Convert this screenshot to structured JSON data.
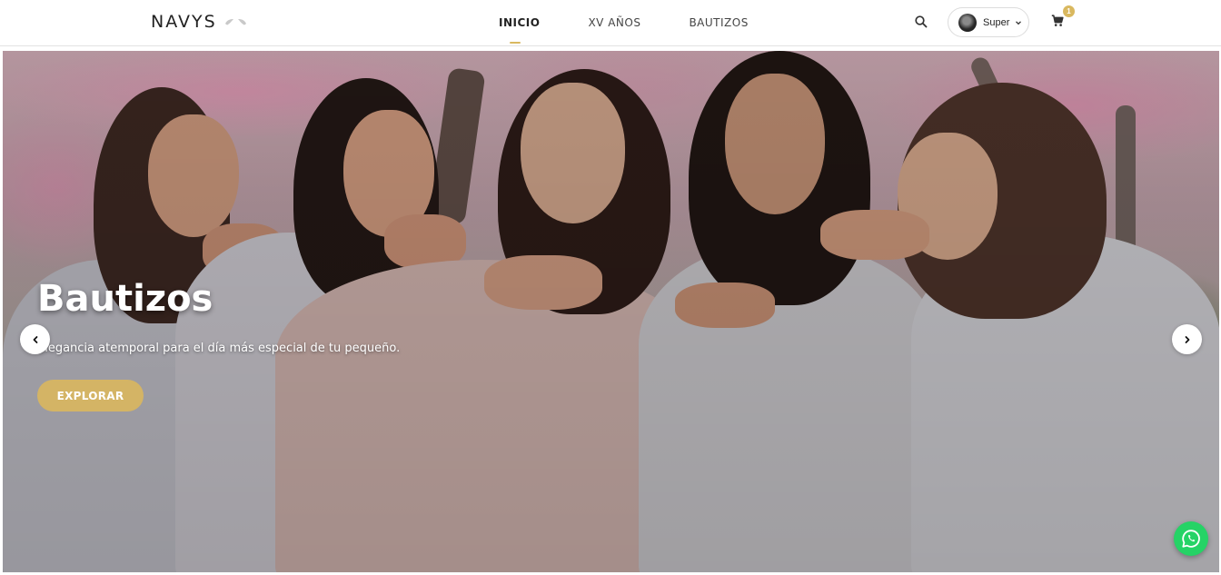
{
  "navbar": {
    "brand": "NAVYS",
    "links": [
      {
        "label": "INICIO",
        "active": true
      },
      {
        "label": "XV AÑOS",
        "active": false
      },
      {
        "label": "BAUTIZOS",
        "active": false
      }
    ],
    "user": {
      "name": "Super"
    },
    "cart": {
      "count": "1"
    }
  },
  "hero": {
    "title": "Bautizos",
    "subtitle": "Elegancia atemporal para el día más especial de tu pequeño.",
    "cta": "EXPLORAR"
  },
  "icons": {
    "search": "search-icon",
    "caret": "chevron-down-icon",
    "cart": "cart-icon",
    "prev": "chevron-left-icon",
    "next": "chevron-right-icon",
    "whatsapp": "whatsapp-icon"
  },
  "colors": {
    "accent": "#d4b465",
    "whatsapp": "#25d366",
    "nav_text": "#444444"
  }
}
